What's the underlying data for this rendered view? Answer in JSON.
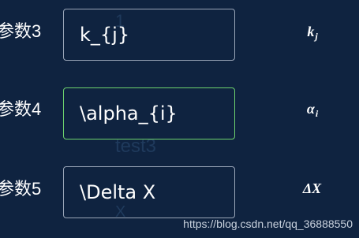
{
  "rows": [
    {
      "label": "参数3",
      "input_value": "k_{j}",
      "preview": {
        "base": "k",
        "sub": "j"
      }
    },
    {
      "label": "参数4",
      "input_value": "\\alpha_{i}",
      "preview": {
        "base": "α",
        "sub": "i"
      }
    },
    {
      "label": "参数5",
      "input_value": "\\Delta X",
      "preview": {
        "base": "ΔX",
        "sub": ""
      }
    }
  ],
  "ghost_texts": {
    "top": "1",
    "middle": "test3",
    "bottom": "X"
  },
  "watermark": "https://blog.csdn.net/qq_36888550"
}
